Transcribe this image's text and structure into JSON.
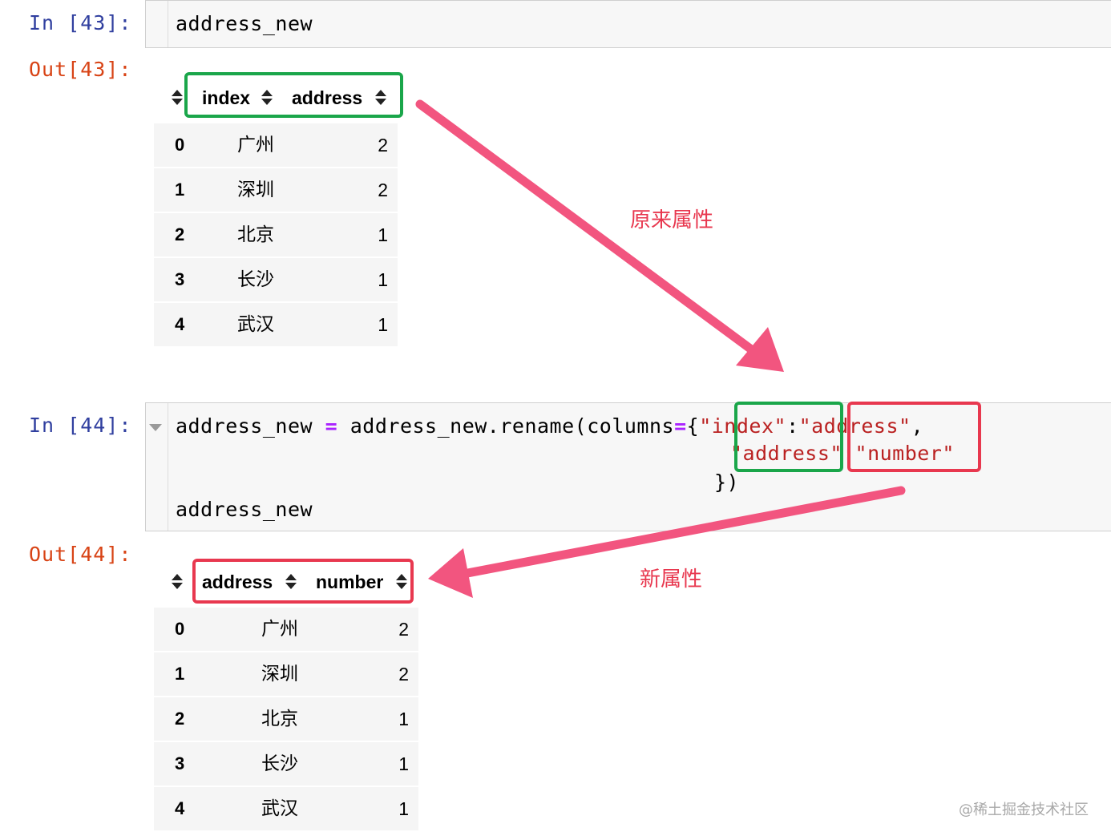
{
  "cell1": {
    "in_prompt": "In [43]:",
    "code": "address_new",
    "out_prompt": "Out[43]:"
  },
  "df1": {
    "columns": [
      "index",
      "address"
    ],
    "rows": [
      {
        "idx": "0",
        "city": "广州",
        "value": "2"
      },
      {
        "idx": "1",
        "city": "深圳",
        "value": "2"
      },
      {
        "idx": "2",
        "city": "北京",
        "value": "1"
      },
      {
        "idx": "3",
        "city": "长沙",
        "value": "1"
      },
      {
        "idx": "4",
        "city": "武汉",
        "value": "1"
      }
    ]
  },
  "cell2": {
    "in_prompt": "In [44]:",
    "line1_a": "address_new ",
    "line1_op": "=",
    "line1_b": " address_new.rename(columns",
    "line1_op2": "=",
    "line1_brace": "{",
    "str_index": "\"index\"",
    "colon": ":",
    "str_address": "\"address\"",
    "comma": ",",
    "str_address2": "\"address\"",
    "str_number": "\"number\"",
    "line3": "})",
    "line4": "address_new",
    "out_prompt": "Out[44]:"
  },
  "df2": {
    "columns": [
      "address",
      "number"
    ],
    "rows": [
      {
        "idx": "0",
        "city": "广州",
        "value": "2"
      },
      {
        "idx": "1",
        "city": "深圳",
        "value": "2"
      },
      {
        "idx": "2",
        "city": "北京",
        "value": "1"
      },
      {
        "idx": "3",
        "city": "长沙",
        "value": "1"
      },
      {
        "idx": "4",
        "city": "武汉",
        "value": "1"
      }
    ]
  },
  "annotations": {
    "original_label": "原来属性",
    "new_label": "新属性",
    "arrow_color": "#f2557f",
    "green": "#1aa64a",
    "red": "#e8384f"
  },
  "watermark": "@稀土掘金技术社区"
}
